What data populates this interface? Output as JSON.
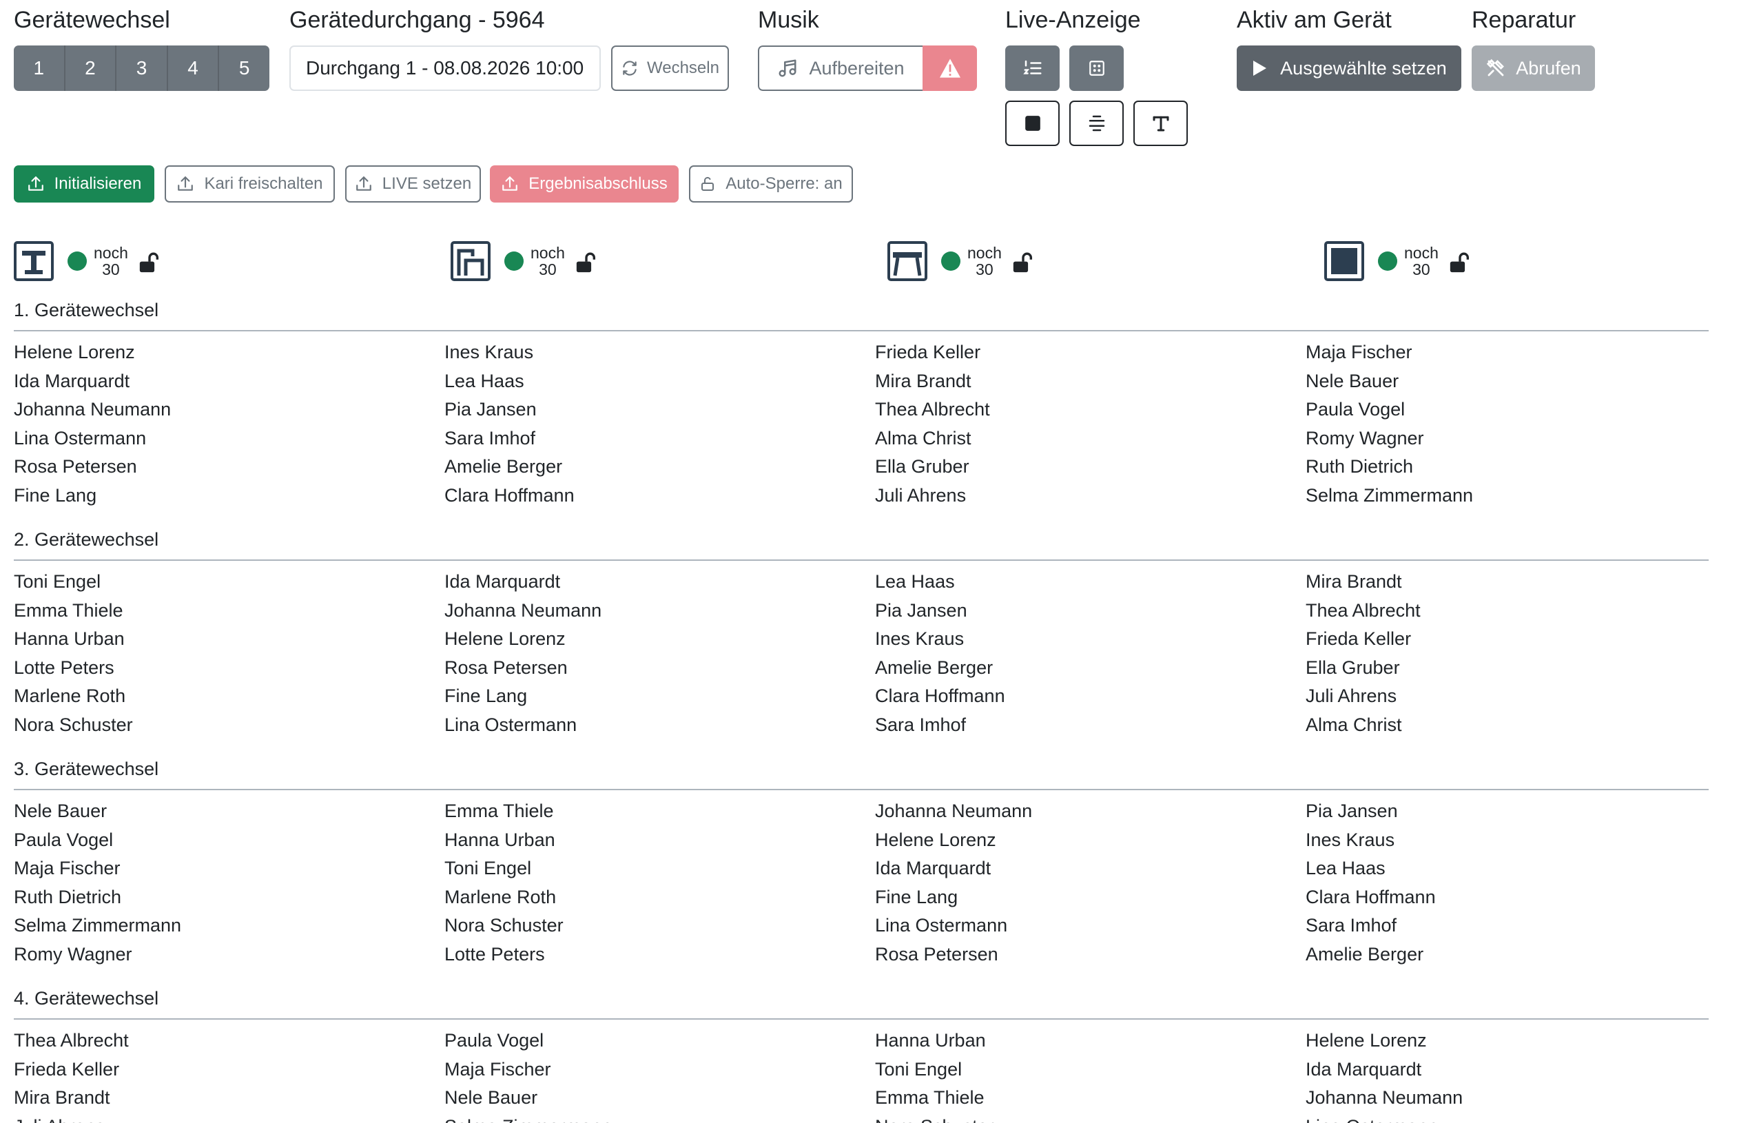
{
  "header": {
    "geraetewechsel_title": "Gerätewechsel",
    "geraetedurchgang_title": "Gerätedurchgang - 5964",
    "musik_title": "Musik",
    "liveanzeige_title": "Live-Anzeige",
    "aktiv_title": "Aktiv am Gerät",
    "reparatur_title": "Reparatur"
  },
  "rotation_buttons": [
    "1",
    "2",
    "3",
    "4",
    "5"
  ],
  "durchgang_select": {
    "value": "Durchgang 1 - 08.08.2026 10:00"
  },
  "wechseln_label": "Wechseln",
  "aufbereiten_label": "Aufbereiten",
  "ausgewaehlte_label": "Ausgewählte setzen",
  "abrufen_label": "Abrufen",
  "actions": {
    "initialisieren": "Initialisieren",
    "kari": "Kari freischalten",
    "live": "LIVE setzen",
    "ergebnis": "Ergebnisabschluss",
    "autosperre": "Auto-Sperre: an"
  },
  "apparatus": [
    {
      "icon": "vault-icon",
      "noch_label": "noch",
      "count": "30"
    },
    {
      "icon": "uneven-bars-icon",
      "noch_label": "noch",
      "count": "30"
    },
    {
      "icon": "beam-icon",
      "noch_label": "noch",
      "count": "30"
    },
    {
      "icon": "floor-icon",
      "noch_label": "noch",
      "count": "30"
    }
  ],
  "rounds": [
    {
      "title": "1. Gerätewechsel",
      "columns": [
        [
          "Helene Lorenz",
          "Ida Marquardt",
          "Johanna Neumann",
          "Lina Ostermann",
          "Rosa Petersen",
          "Fine Lang"
        ],
        [
          "Ines Kraus",
          "Lea Haas",
          "Pia Jansen",
          "Sara Imhof",
          "Amelie Berger",
          "Clara Hoffmann"
        ],
        [
          "Frieda Keller",
          "Mira Brandt",
          "Thea Albrecht",
          "Alma Christ",
          "Ella Gruber",
          "Juli Ahrens"
        ],
        [
          "Maja Fischer",
          "Nele Bauer",
          "Paula Vogel",
          "Romy Wagner",
          "Ruth Dietrich",
          "Selma Zimmermann"
        ]
      ]
    },
    {
      "title": "2. Gerätewechsel",
      "columns": [
        [
          "Toni Engel",
          "Emma Thiele",
          "Hanna Urban",
          "Lotte Peters",
          "Marlene Roth",
          "Nora Schuster"
        ],
        [
          "Ida Marquardt",
          "Johanna Neumann",
          "Helene Lorenz",
          "Rosa Petersen",
          "Fine Lang",
          "Lina Ostermann"
        ],
        [
          "Lea Haas",
          "Pia Jansen",
          "Ines Kraus",
          "Amelie Berger",
          "Clara Hoffmann",
          "Sara Imhof"
        ],
        [
          "Mira Brandt",
          "Thea Albrecht",
          "Frieda Keller",
          "Ella Gruber",
          "Juli Ahrens",
          "Alma Christ"
        ]
      ]
    },
    {
      "title": "3. Gerätewechsel",
      "columns": [
        [
          "Nele Bauer",
          "Paula Vogel",
          "Maja Fischer",
          "Ruth Dietrich",
          "Selma Zimmermann",
          "Romy Wagner"
        ],
        [
          "Emma Thiele",
          "Hanna Urban",
          "Toni Engel",
          "Marlene Roth",
          "Nora Schuster",
          "Lotte Peters"
        ],
        [
          "Johanna Neumann",
          "Helene Lorenz",
          "Ida Marquardt",
          "Fine Lang",
          "Lina Ostermann",
          "Rosa Petersen"
        ],
        [
          "Pia Jansen",
          "Ines Kraus",
          "Lea Haas",
          "Clara Hoffmann",
          "Sara Imhof",
          "Amelie Berger"
        ]
      ]
    },
    {
      "title": "4. Gerätewechsel",
      "columns": [
        [
          "Thea Albrecht",
          "Frieda Keller",
          "Mira Brandt",
          "Juli Ahrens"
        ],
        [
          "Paula Vogel",
          "Maja Fischer",
          "Nele Bauer",
          "Selma Zimmermann"
        ],
        [
          "Hanna Urban",
          "Toni Engel",
          "Emma Thiele",
          "Nora Schuster"
        ],
        [
          "Helene Lorenz",
          "Ida Marquardt",
          "Johanna Neumann",
          "Lina Ostermann"
        ]
      ]
    }
  ]
}
